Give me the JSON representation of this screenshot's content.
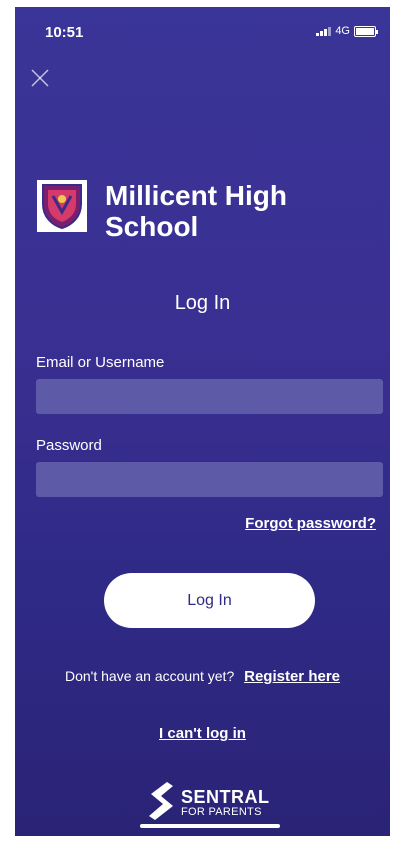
{
  "status_bar": {
    "time": "10:51",
    "network": "4G"
  },
  "header": {
    "close_icon": "close-icon",
    "school_name": "Millicent High School"
  },
  "login": {
    "title": "Log In",
    "email_label": "Email or Username",
    "email_value": "",
    "password_label": "Password",
    "password_value": "",
    "forgot_password": "Forgot password?",
    "login_button": "Log In",
    "no_account_text": "Don't have an account yet?",
    "register_link": "Register here",
    "cant_login": "I can't log in"
  },
  "brand": {
    "name": "SENTRAL",
    "subtitle": "FOR PARENTS"
  },
  "colors": {
    "background": "#3a3598",
    "input_fill": "#5d5aa8",
    "button_bg": "#ffffff",
    "button_text": "#2f2a86"
  }
}
